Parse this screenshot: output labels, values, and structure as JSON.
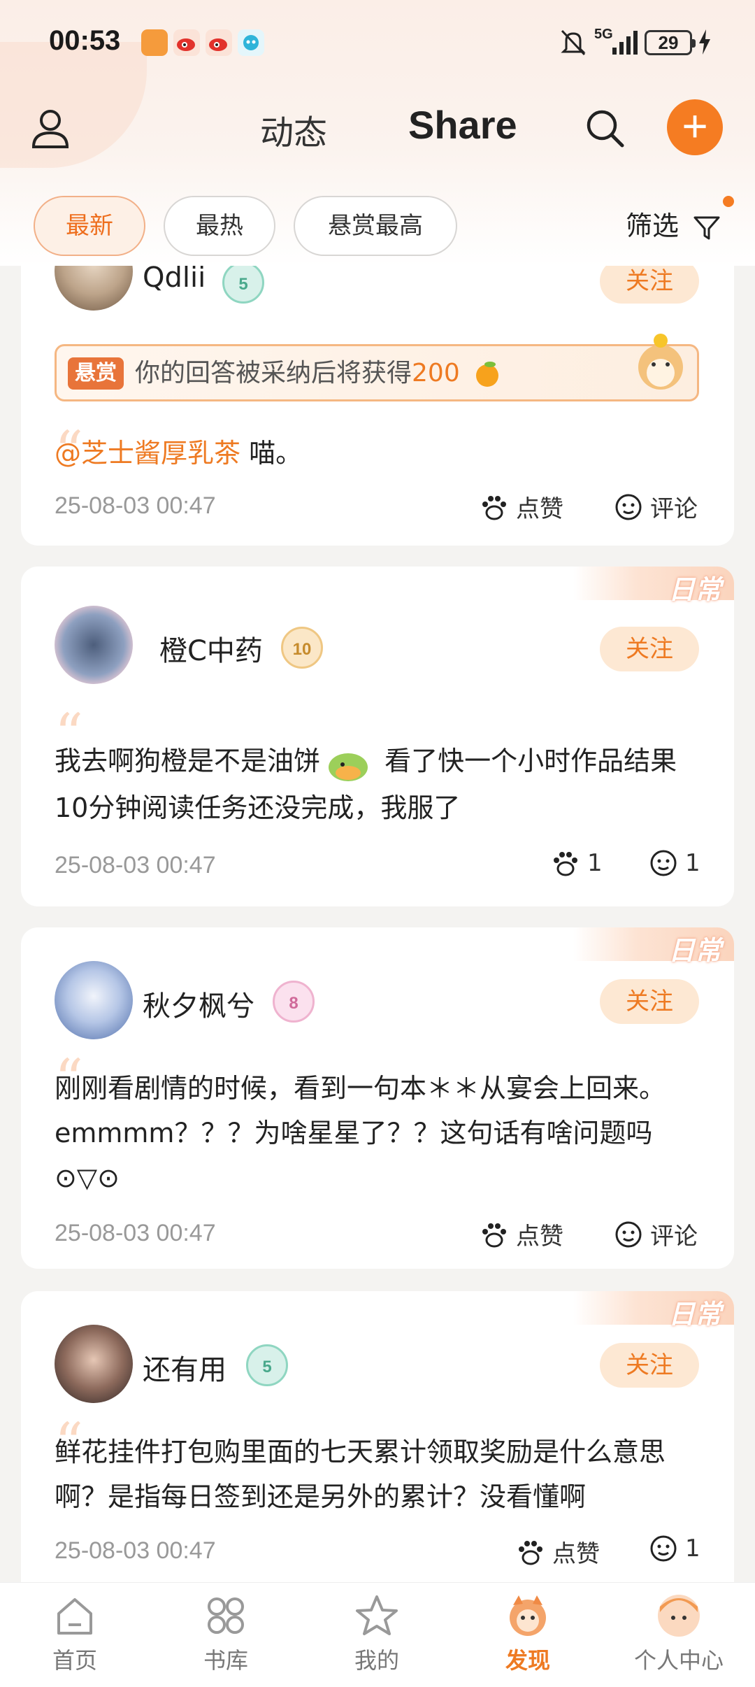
{
  "status_bar": {
    "time": "00:53",
    "network": "5G",
    "battery": "29"
  },
  "header": {
    "tab_dynamic": "动态",
    "tab_share": "Share",
    "search_icon": "search-icon",
    "add_icon": "plus-icon"
  },
  "filters": {
    "chips": [
      "最新",
      "最热",
      "悬赏最高"
    ],
    "active": "最新",
    "filter_label": "筛选"
  },
  "posts": [
    {
      "username": "Qdlii",
      "level": "5",
      "follow_label": "关注",
      "reward": {
        "tag": "悬赏",
        "text": "你的回答被采纳后将获得",
        "amount": "200"
      },
      "mention": "@芝士酱厚乳茶",
      "content": " 喵。",
      "timestamp": "25-08-03 00:47",
      "like_label": "点赞",
      "comment_label": "评论"
    },
    {
      "username": "橙C中药",
      "level": "10",
      "follow_label": "关注",
      "tag": "日常",
      "content_a": "我去啊狗橙是不是油饼",
      "content_b": " 看了快一个小时作品结果10分钟阅读任务还没完成，我服了",
      "timestamp": "25-08-03 00:47",
      "like_label": "1",
      "comment_label": "1"
    },
    {
      "username": "秋夕枫兮",
      "level": "8",
      "follow_label": "关注",
      "tag": "日常",
      "content": "刚刚看剧情的时候，看到一句本＊＊从宴会上回来。emmmm？？？为啥星星了？？这句话有啥问题吗⊙▽⊙",
      "timestamp": "25-08-03 00:47",
      "like_label": "点赞",
      "comment_label": "评论"
    },
    {
      "username": "还有用",
      "level": "5",
      "follow_label": "关注",
      "tag": "日常",
      "content": "鲜花挂件打包购里面的七天累计领取奖励是什么意思啊？是指每日签到还是另外的累计？没看懂啊",
      "timestamp": "25-08-03 00:47",
      "like_label": "点赞",
      "comment_label": "1"
    }
  ],
  "bottom_nav": {
    "items": [
      "首页",
      "书库",
      "我的",
      "发现",
      "个人中心"
    ],
    "active": "发现"
  },
  "colors": {
    "accent": "#f57c22",
    "follow_bg": "#fde8d3",
    "page_bg": "#f4f3f1"
  }
}
